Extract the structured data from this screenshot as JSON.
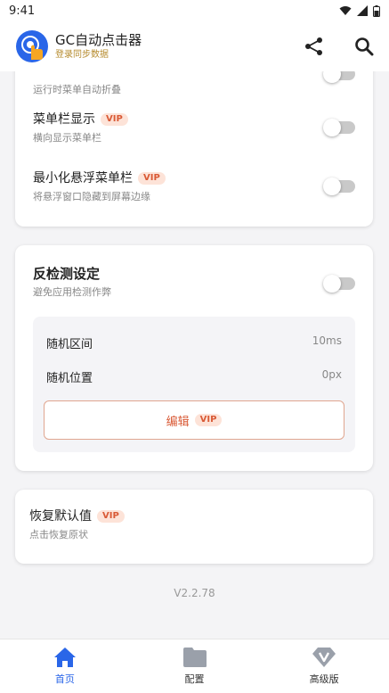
{
  "status_bar": {
    "time": "9:41",
    "icons": [
      "wifi-icon",
      "signal-icon",
      "battery-icon"
    ]
  },
  "app_bar": {
    "title": "GC自动点击器",
    "subtitle": "登录同步数据",
    "actions": [
      "share-icon",
      "search-icon"
    ]
  },
  "settings_card": {
    "partial_item": {
      "subtitle": "运行时菜单自动折叠",
      "enabled": false
    },
    "items": [
      {
        "title": "菜单栏显示",
        "badge": "VIP",
        "subtitle": "横向显示菜单栏",
        "enabled": false
      },
      {
        "title": "最小化悬浮菜单栏",
        "badge": "VIP",
        "subtitle": "将悬浮窗口隐藏到屏幕边缘",
        "enabled": false
      }
    ]
  },
  "anti_detect_card": {
    "title": "反检测设定",
    "subtitle": "避免应用检测作弊",
    "enabled": false,
    "fields": [
      {
        "label": "随机区间",
        "value": "10ms"
      },
      {
        "label": "随机位置",
        "value": "0px"
      }
    ],
    "edit_label": "编辑",
    "edit_badge": "VIP"
  },
  "reset_card": {
    "title": "恢复默认值",
    "badge": "VIP",
    "subtitle": "点击恢复原状"
  },
  "version": "V2.2.78",
  "bottom_nav": [
    {
      "label": "首页",
      "icon": "home-icon",
      "active": true
    },
    {
      "label": "配置",
      "icon": "folder-icon",
      "active": false
    },
    {
      "label": "高级版",
      "icon": "diamond-icon",
      "active": false
    }
  ],
  "colors": {
    "accent": "#2a66e8",
    "vip_text": "#d95a36",
    "vip_bg": "#fde3d8",
    "subtitle_gold": "#b68b2e"
  }
}
